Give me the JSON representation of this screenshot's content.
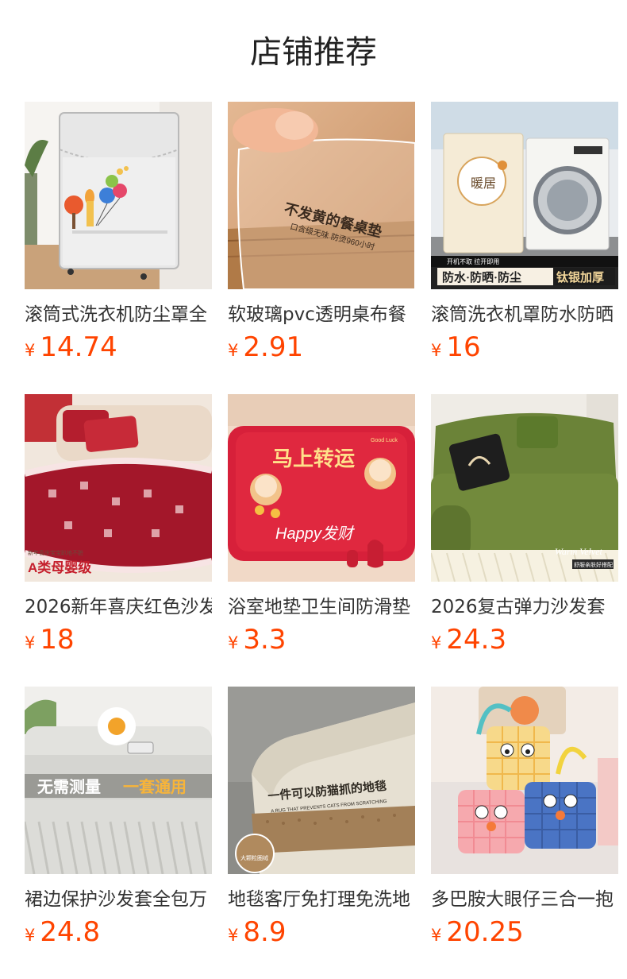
{
  "header": {
    "title": "店铺推荐"
  },
  "theme": {
    "price_color": "#ff4400"
  },
  "products": [
    {
      "title": "滚筒式洗衣机防尘罩全",
      "currency": "¥",
      "price": "14.74",
      "image_icon": "washer-cover-image"
    },
    {
      "title": "软玻璃pvc透明桌布餐",
      "currency": "¥",
      "price": "2.91",
      "image_icon": "table-mat-image",
      "image_text": {
        "line1": "不发黄的餐桌垫",
        "line2": "口含级无味  防烫960小时"
      }
    },
    {
      "title": "滚筒洗衣机罩防水防晒",
      "currency": "¥",
      "price": "16",
      "image_icon": "washer-cover-image",
      "image_text": {
        "badge": "暖居",
        "top": "开机不取 拉开即用",
        "left": "防水·防晒·防尘",
        "right": "钛银加厚"
      }
    },
    {
      "title": "2026新年喜庆红色沙发",
      "currency": "¥",
      "price": "18",
      "image_icon": "sofa-cover-image",
      "image_text": {
        "line1": "新年喜庆宝宝趴地不脏",
        "line2": "A类母婴级"
      }
    },
    {
      "title": "浴室地垫卫生间防滑垫",
      "currency": "¥",
      "price": "3.3",
      "image_icon": "bath-mat-image",
      "image_text": {
        "line1": "马上转运",
        "line2": "Happy发财",
        "line3": "Good Luck"
      }
    },
    {
      "title": "2026复古弹力沙发套",
      "currency": "¥",
      "price": "24.3",
      "image_icon": "sofa-cover-image",
      "image_text": {
        "line1": "Warm Velvet",
        "line2": "舒服亲肤好搭配"
      }
    },
    {
      "title": "裙边保护沙发套全包万",
      "currency": "¥",
      "price": "24.8",
      "image_icon": "sofa-skirt-image",
      "image_text": {
        "left": "无需测量",
        "right": "一套通用"
      }
    },
    {
      "title": "地毯客厅免打理免洗地",
      "currency": "¥",
      "price": "8.9",
      "image_icon": "rug-image",
      "image_text": {
        "line1": "一件可以防猫抓的地毯",
        "line2": "A RUG THAT PREVENTS CATS FROM SCRATCHING",
        "badge": "大颗粒圈绒"
      }
    },
    {
      "title": "多巴胺大眼仔三合一抱",
      "currency": "¥",
      "price": "20.25",
      "image_icon": "pillow-image"
    }
  ]
}
